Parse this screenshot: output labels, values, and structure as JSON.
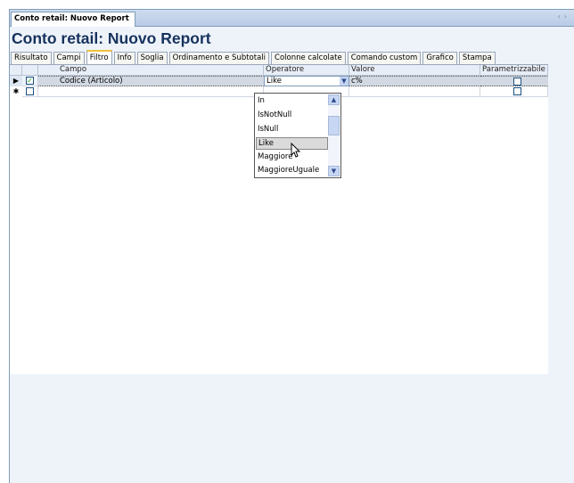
{
  "document_tab": {
    "label": "Conto retail: Nuovo Report"
  },
  "nav": {
    "prev_icon": "‹",
    "next_icon": "›"
  },
  "page_title": "Conto retail: Nuovo Report",
  "tabs": [
    {
      "label": "Risultato",
      "active": false
    },
    {
      "label": "Campi",
      "active": false
    },
    {
      "label": "Filtro",
      "active": true
    },
    {
      "label": "Info",
      "active": false
    },
    {
      "label": "Soglia",
      "active": false
    },
    {
      "label": "Ordinamento e Subtotali",
      "active": false
    },
    {
      "label": "Colonne calcolate",
      "active": false
    },
    {
      "label": "Comando custom",
      "active": false
    },
    {
      "label": "Grafico",
      "active": false
    },
    {
      "label": "Stampa",
      "active": false
    }
  ],
  "grid": {
    "columns": {
      "campo": "Campo",
      "operatore": "Operatore",
      "valore": "Valore",
      "parametrizzabile": "Parametrizzabile"
    },
    "rows": [
      {
        "indicator": "▶",
        "checked": true,
        "campo": "Codice (Articolo)",
        "operatore": "Like",
        "valore": "c%",
        "parametrizzabile": false
      },
      {
        "indicator": "✱",
        "checked": false,
        "campo": "",
        "operatore": "",
        "valore": "",
        "parametrizzabile": false
      }
    ]
  },
  "operator_dropdown": {
    "items": [
      "In",
      "IsNotNull",
      "IsNull",
      "Like",
      "Maggiore",
      "MaggioreUguale"
    ],
    "highlighted": "Like"
  },
  "colors": {
    "title": "#16325c",
    "tab_accent": "#f0c040",
    "frame": "#7f9db9"
  }
}
